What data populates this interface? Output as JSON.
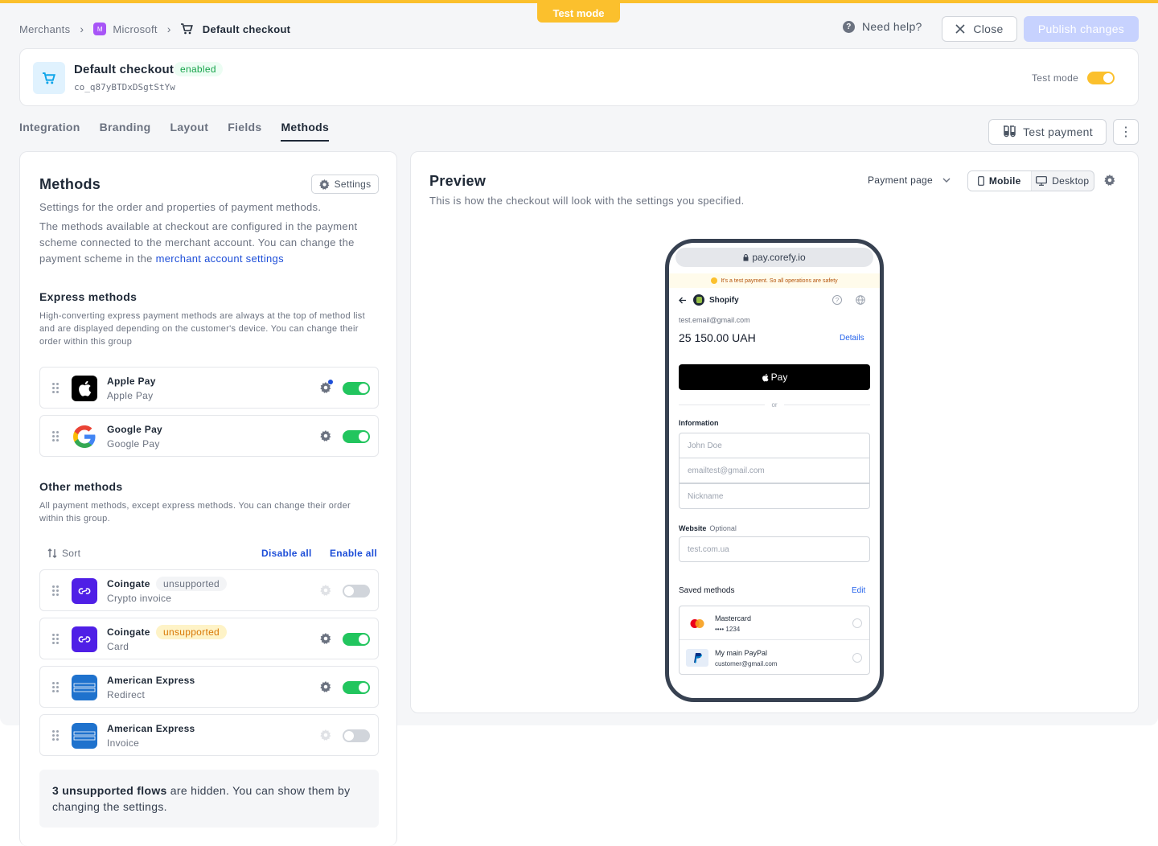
{
  "banner": {
    "test_mode": "Test mode"
  },
  "breadcrumb": {
    "merchants": "Merchants",
    "merchant_initial": "M",
    "merchant": "Microsoft",
    "current": "Default checkout"
  },
  "header": {
    "help": "Need help?",
    "close": "Close",
    "publish": "Publish changes"
  },
  "checkout": {
    "title": "Default checkout",
    "status": "enabled",
    "id": "co_q87yBTDxDSgtStYw",
    "test_mode_label": "Test mode",
    "test_mode_on": true
  },
  "tabs": [
    {
      "label": "Integration"
    },
    {
      "label": "Branding"
    },
    {
      "label": "Layout"
    },
    {
      "label": "Fields"
    },
    {
      "label": "Methods"
    }
  ],
  "actions": {
    "test_payment": "Test payment",
    "more": "⋮"
  },
  "methods_panel": {
    "title": "Methods",
    "settings": "Settings",
    "description_1": "Settings for the order and properties of payment methods.",
    "description_2": "The methods available at checkout are configured in the payment scheme connected to the merchant account. You can change the payment scheme in the ",
    "description_link": "merchant account settings",
    "express": {
      "title": "Express methods",
      "description": "High-converting express payment methods are always at the top of method list and are displayed depending on the customer's device. You can change their order within this group",
      "items": [
        {
          "name": "Apple Pay",
          "sub": "Apple Pay",
          "enabled": true
        },
        {
          "name": "Google Pay",
          "sub": "Google Pay",
          "enabled": true
        }
      ]
    },
    "other": {
      "title": "Other methods",
      "description": "All payment methods, except express methods. You can change their order within this group.",
      "sort": "Sort",
      "disable_all": "Disable all",
      "enable_all": "Enable all",
      "items": [
        {
          "name": "Coingate",
          "badge": "unsupported",
          "sub": "Crypto invoice",
          "enabled": false
        },
        {
          "name": "Coingate",
          "badge": "unsupported",
          "sub": "Card",
          "enabled": true
        },
        {
          "name": "American Express",
          "sub": "Redirect",
          "enabled": true
        },
        {
          "name": "American Express",
          "sub": "Invoice",
          "enabled": false
        }
      ]
    },
    "note_bold": "3 unsupported flows",
    "note_rest": " are hidden. You can show them by changing the settings."
  },
  "preview": {
    "title": "Preview",
    "description": "This is how the checkout will look with the settings you specified.",
    "page_select": "Payment page",
    "mobile": "Mobile",
    "desktop": "Desktop",
    "phone": {
      "url": "pay.corefy.io",
      "test_notice": "It's a test payment. So all operations are safety",
      "shop": "Shopify",
      "email": "test.email@gmail.com",
      "amount": "25 150.00 UAH",
      "details": "Details",
      "pay": "Pay",
      "or": "or",
      "information": "Information",
      "name_placeholder": "John Doe",
      "email_placeholder": "emailtest@gmail.com",
      "nickname_placeholder": "Nickname",
      "website": "Website",
      "optional": "Optional",
      "website_placeholder": "test.com.ua",
      "saved_methods": "Saved methods",
      "edit": "Edit",
      "saved": [
        {
          "name": "Mastercard",
          "sub": "•••• 1234"
        },
        {
          "name": "My main PayPal",
          "sub": "customer@gmail.com"
        }
      ]
    }
  },
  "colors": {
    "accent": "#1d4ed8",
    "test_mode": "#fbc02d",
    "toggle_on": "#22c55e",
    "publish_disabled": "#c7d2fe"
  }
}
